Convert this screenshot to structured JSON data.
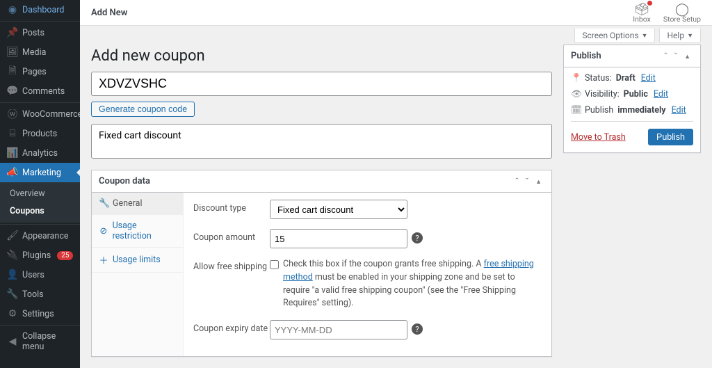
{
  "sidebar": {
    "items": [
      {
        "label": "Dashboard"
      },
      {
        "label": "Posts"
      },
      {
        "label": "Media"
      },
      {
        "label": "Pages"
      },
      {
        "label": "Comments"
      },
      {
        "label": "WooCommerce"
      },
      {
        "label": "Products"
      },
      {
        "label": "Analytics"
      },
      {
        "label": "Marketing"
      },
      {
        "label": "Appearance"
      },
      {
        "label": "Plugins",
        "badge": "25"
      },
      {
        "label": "Users"
      },
      {
        "label": "Tools"
      },
      {
        "label": "Settings"
      },
      {
        "label": "Collapse menu"
      }
    ],
    "submenu": [
      {
        "label": "Overview"
      },
      {
        "label": "Coupons"
      }
    ]
  },
  "topbar": {
    "title": "Add New",
    "inbox": "Inbox",
    "setup": "Store Setup"
  },
  "screen_meta": {
    "screen_options": "Screen Options",
    "help": "Help"
  },
  "page": {
    "heading": "Add new coupon",
    "coupon_code": "XDVZVSHC",
    "generate_btn": "Generate coupon code",
    "description": "Fixed cart discount"
  },
  "coupon_panel": {
    "title": "Coupon data",
    "tabs": {
      "general": "General",
      "usage_restriction": "Usage restriction",
      "usage_limits": "Usage limits"
    },
    "fields": {
      "discount_type_label": "Discount type",
      "discount_type_value": "Fixed cart discount",
      "coupon_amount_label": "Coupon amount",
      "coupon_amount_value": "15",
      "free_shipping_label": "Allow free shipping",
      "free_shipping_pre": "Check this box if the coupon grants free shipping. A ",
      "free_shipping_link": "free shipping method",
      "free_shipping_post": " must be enabled in your shipping zone and be set to require \"a valid free shipping coupon\" (see the \"Free Shipping Requires\" setting).",
      "expiry_label": "Coupon expiry date",
      "expiry_placeholder": "YYYY-MM-DD"
    }
  },
  "publish": {
    "title": "Publish",
    "status_label": "Status:",
    "status_value": "Draft",
    "visibility_label": "Visibility:",
    "visibility_value": "Public",
    "publish_label": "Publish",
    "publish_value": "immediately",
    "edit": "Edit",
    "trash": "Move to Trash",
    "button": "Publish"
  }
}
